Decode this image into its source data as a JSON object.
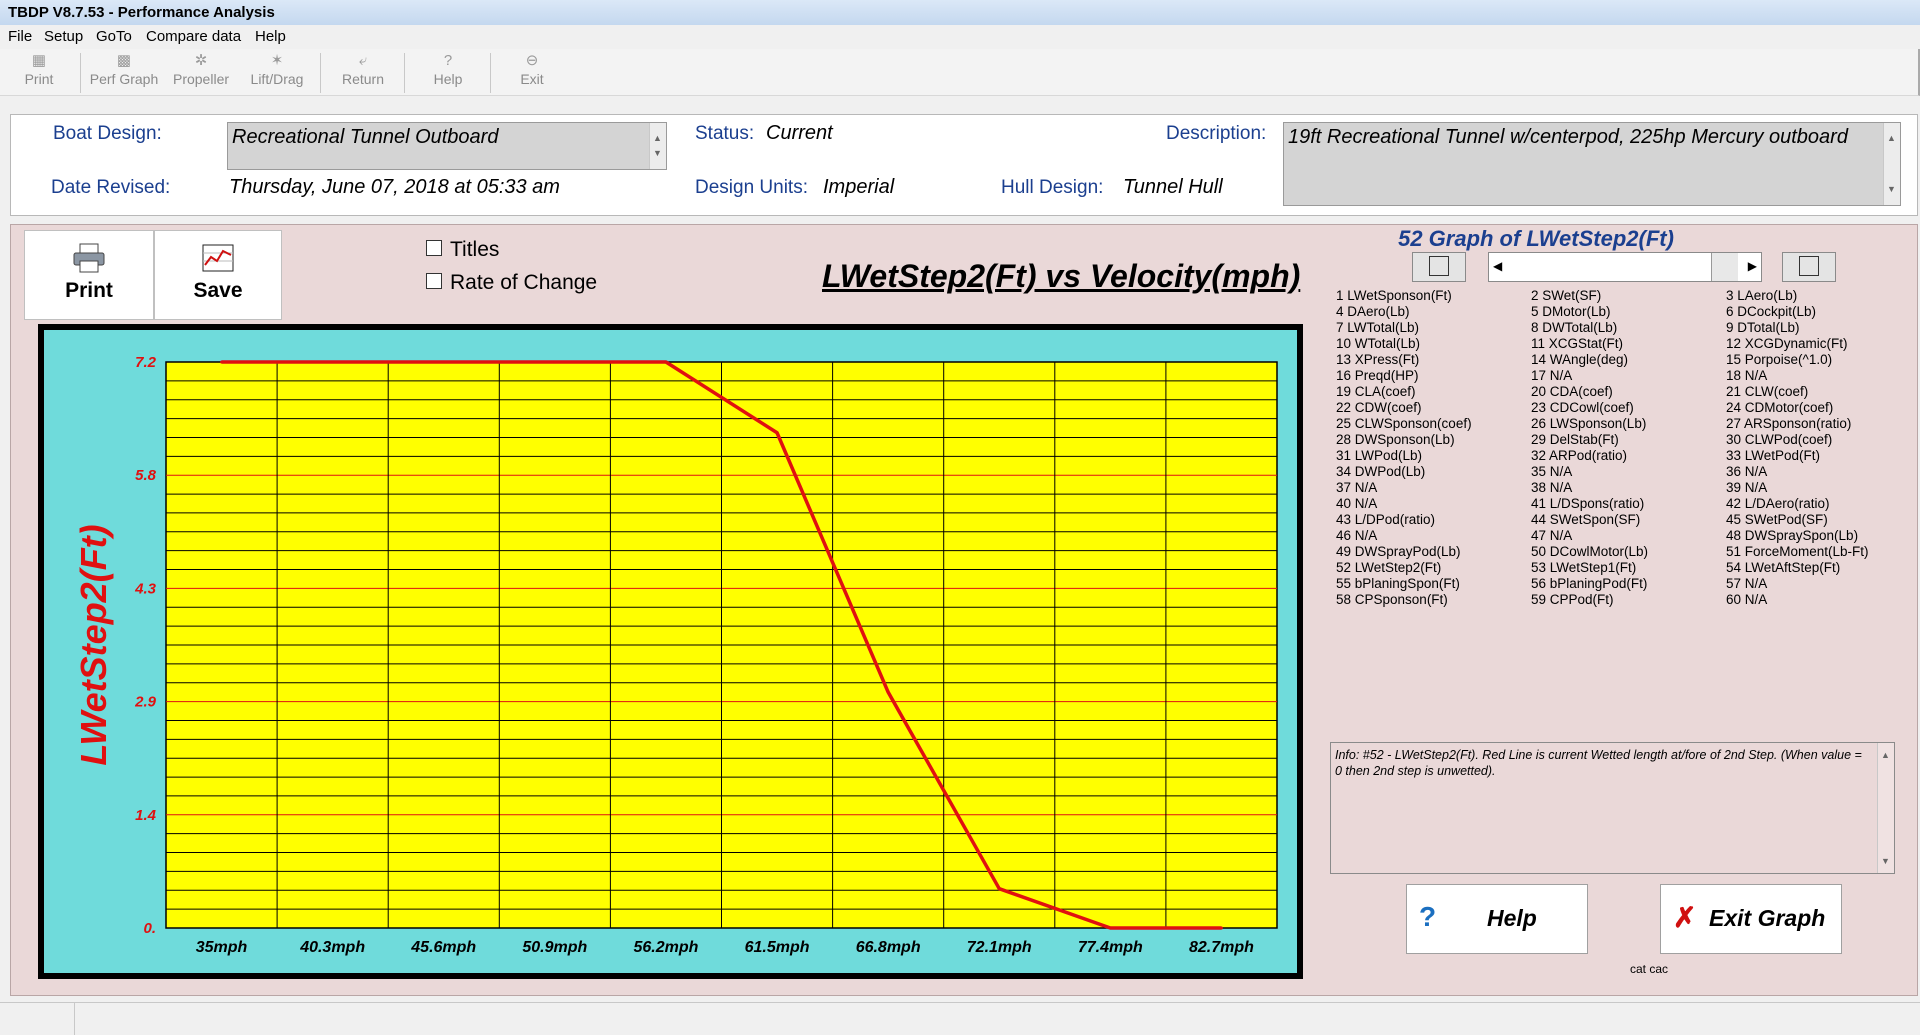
{
  "window": {
    "title": "TBDP V8.7.53 - Performance Analysis"
  },
  "menu": [
    "File",
    "Setup",
    "GoTo",
    "Compare data",
    "Help"
  ],
  "toolbar": {
    "print": "Print",
    "perf_graph": "Perf Graph",
    "propeller": "Propeller",
    "lift_drag": "Lift/Drag",
    "return": "Return",
    "help": "Help",
    "exit": "Exit"
  },
  "header": {
    "boat_design_label": "Boat Design:",
    "boat_design_value": "Recreational Tunnel Outboard",
    "status_label": "Status:",
    "status_value": "Current",
    "description_label": "Description:",
    "description_value": "19ft Recreational Tunnel w/centerpod, 225hp Mercury outboard",
    "date_label": "Date Revised:",
    "date_value": "Thursday, June 07, 2018 at 05:33 am",
    "units_label": "Design Units:",
    "units_value": "Imperial",
    "hull_label": "Hull Design:",
    "hull_value": "Tunnel Hull"
  },
  "graph_panel": {
    "print_label": "Print",
    "save_label": "Save",
    "titles_checkbox": "Titles",
    "rate_checkbox": "Rate of Change",
    "graph_title": "LWetStep2(Ft) vs Velocity(mph)"
  },
  "chart_data": {
    "type": "line",
    "title": "LWetStep2(Ft) vs Velocity(mph)",
    "xlabel": "",
    "ylabel": "LWetStep2(Ft)",
    "categories": [
      "35mph",
      "40.3mph",
      "45.6mph",
      "50.9mph",
      "56.2mph",
      "61.5mph",
      "66.8mph",
      "72.1mph",
      "77.4mph",
      "82.7mph"
    ],
    "y_tick_labels": [
      "7.2",
      "5.8",
      "4.3",
      "2.9",
      "1.4",
      "0."
    ],
    "ylim": [
      0,
      7.2
    ],
    "x": [
      35,
      40.3,
      45.6,
      50.9,
      56.2,
      61.5,
      66.8,
      72.1,
      77.4,
      82.7
    ],
    "xlim": [
      32.35,
      85.35
    ],
    "series": [
      {
        "x": [
          35,
          40.3,
          45.6,
          50.9,
          56.2,
          61.5,
          66.8,
          72.1,
          77.4,
          82.7
        ],
        "values": [
          7.2,
          7.2,
          7.2,
          7.2,
          7.2,
          6.3,
          3.0,
          0.5,
          0.0,
          0.0
        ],
        "color": "#e01010"
      }
    ],
    "grid": true,
    "plot_background": "#ffff00",
    "frame_background": "#6fdbdb"
  },
  "options": {
    "title": "52 Graph of LWetStep2(Ft)",
    "items": [
      "1 LWetSponson(Ft)",
      "2 SWet(SF)",
      "3 LAero(Lb)",
      "4 DAero(Lb)",
      "5 DMotor(Lb)",
      "6 DCockpit(Lb)",
      "7 LWTotal(Lb)",
      "8 DWTotal(Lb)",
      "9 DTotal(Lb)",
      "10 WTotal(Lb)",
      "11 XCGStat(Ft)",
      "12 XCGDynamic(Ft)",
      "13 XPress(Ft)",
      "14 WAngle(deg)",
      "15 Porpoise(^1.0)",
      "16 Preqd(HP)",
      "17 N/A",
      "18 N/A",
      "19 CLA(coef)",
      "20 CDA(coef)",
      "21 CLW(coef)",
      "22 CDW(coef)",
      "23 CDCowl(coef)",
      "24 CDMotor(coef)",
      "25 CLWSponson(coef)",
      "26 LWSponson(Lb)",
      "27 ARSponson(ratio)",
      "28 DWSponson(Lb)",
      "29 DelStab(Ft)",
      "30 CLWPod(coef)",
      "31 LWPod(Lb)",
      "32 ARPod(ratio)",
      "33 LWetPod(Ft)",
      "34 DWPod(Lb)",
      "35 N/A",
      "36 N/A",
      "37 N/A",
      "38 N/A",
      "39 N/A",
      "40 N/A",
      "41 L/DSpons(ratio)",
      "42 L/DAero(ratio)",
      "43 L/DPod(ratio)",
      "44 SWetSpon(SF)",
      "45 SWetPod(SF)",
      "46 N/A",
      "47 N/A",
      "48 DWSpraySpon(Lb)",
      "49 DWSprayPod(Lb)",
      "50 DCowlMotor(Lb)",
      "51 ForceMoment(Lb-Ft)",
      "52 LWetStep2(Ft)",
      "53 LWetStep1(Ft)",
      "54 LWetAftStep(Ft)",
      "55 bPlaningSpon(Ft)",
      "56 bPlaningPod(Ft)",
      "57 N/A",
      "58 CPSponson(Ft)",
      "59 CPPod(Ft)",
      "60 N/A"
    ]
  },
  "info": {
    "text": "Info: #52 - LWetStep2(Ft). Red Line is current Wetted length at/fore of 2nd Step.  (When value = 0 then 2nd step is unwetted)."
  },
  "actions": {
    "help_label": "Help",
    "exit_label": "Exit Graph",
    "footer_note": "cat cac"
  },
  "icons": [
    "printer-icon",
    "save-graph-icon",
    "help-icon",
    "exit-icon",
    "first-record-icon",
    "last-record-icon",
    "scroll-left-icon",
    "scroll-right-icon"
  ]
}
